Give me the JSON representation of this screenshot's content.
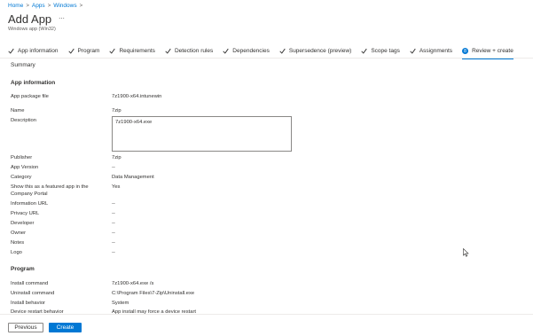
{
  "breadcrumb": [
    "Home",
    "Apps",
    "Windows"
  ],
  "header": {
    "title": "Add App",
    "more": "...",
    "subtitle": "Windows app (Win32)"
  },
  "steps": [
    {
      "label": "App information"
    },
    {
      "label": "Program"
    },
    {
      "label": "Requirements"
    },
    {
      "label": "Detection rules"
    },
    {
      "label": "Dependencies"
    },
    {
      "label": "Supersedence (preview)"
    },
    {
      "label": "Scope tags"
    },
    {
      "label": "Assignments"
    },
    {
      "label": "Review + create",
      "number": "8"
    }
  ],
  "summary": "Summary",
  "app_info": {
    "heading": "App information",
    "package_label": "App package file",
    "package_value": "7z1900-x64.intunewin",
    "name_label": "Name",
    "name_value": "7zip",
    "description_label": "Description",
    "description_value": "7z1900-x64.exe",
    "publisher_label": "Publisher",
    "publisher_value": "7zip",
    "version_label": "App Version",
    "version_value": "--",
    "category_label": "Category",
    "category_value": "Data Management",
    "featured_label": "Show this as a featured app in the Company Portal",
    "featured_value": "Yes",
    "info_url_label": "Information URL",
    "info_url_value": "--",
    "privacy_url_label": "Privacy URL",
    "privacy_url_value": "--",
    "developer_label": "Developer",
    "developer_value": "--",
    "owner_label": "Owner",
    "owner_value": "--",
    "notes_label": "Notes",
    "notes_value": "--",
    "logo_label": "Logo",
    "logo_value": "--"
  },
  "program": {
    "heading": "Program",
    "install_label": "Install command",
    "install_value": "7z1900-x64.exe /s",
    "uninstall_label": "Uninstall command",
    "uninstall_value": "C:\\Program Files\\7-Zip\\Uninstall.exe",
    "behavior_label": "Install behavior",
    "behavior_value": "System",
    "restart_label": "Device restart behavior",
    "restart_value": "App install may force a device restart"
  },
  "footer": {
    "previous": "Previous",
    "create": "Create"
  },
  "colors": {
    "accent": "#0078d4"
  }
}
